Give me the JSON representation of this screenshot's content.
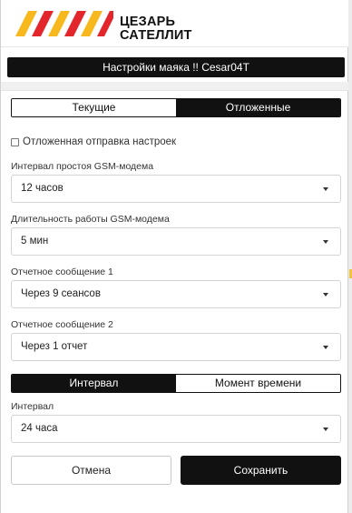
{
  "brand": {
    "line1": "ЦЕЗАРЬ",
    "line2": "САТЕЛЛИТ",
    "accent_red": "#e3262b",
    "accent_yellow": "#f6b81c"
  },
  "title": "Настройки маяка !! Cesar04T",
  "tabs": {
    "current": "Текущие",
    "deferred": "Отложенные",
    "active": "deferred"
  },
  "deferred_checkbox": {
    "label": "Отложенная отправка настроек",
    "checked": false
  },
  "fields": {
    "gsm_idle_interval": {
      "label": "Интервал простоя GSM-модема",
      "value": "12 часов"
    },
    "gsm_work_duration": {
      "label": "Длительность работы GSM-модема",
      "value": "5 мин"
    },
    "report_message_1": {
      "label": "Отчетное сообщение 1",
      "value": "Через 9 сеансов"
    },
    "report_message_2": {
      "label": "Отчетное сообщение 2",
      "value": "Через 1 отчет"
    }
  },
  "mode_tabs": {
    "interval": "Интервал",
    "moment": "Момент времени",
    "active": "interval"
  },
  "interval_field": {
    "label": "Интервал",
    "value": "24 часа"
  },
  "buttons": {
    "cancel": "Отмена",
    "save": "Сохранить"
  }
}
